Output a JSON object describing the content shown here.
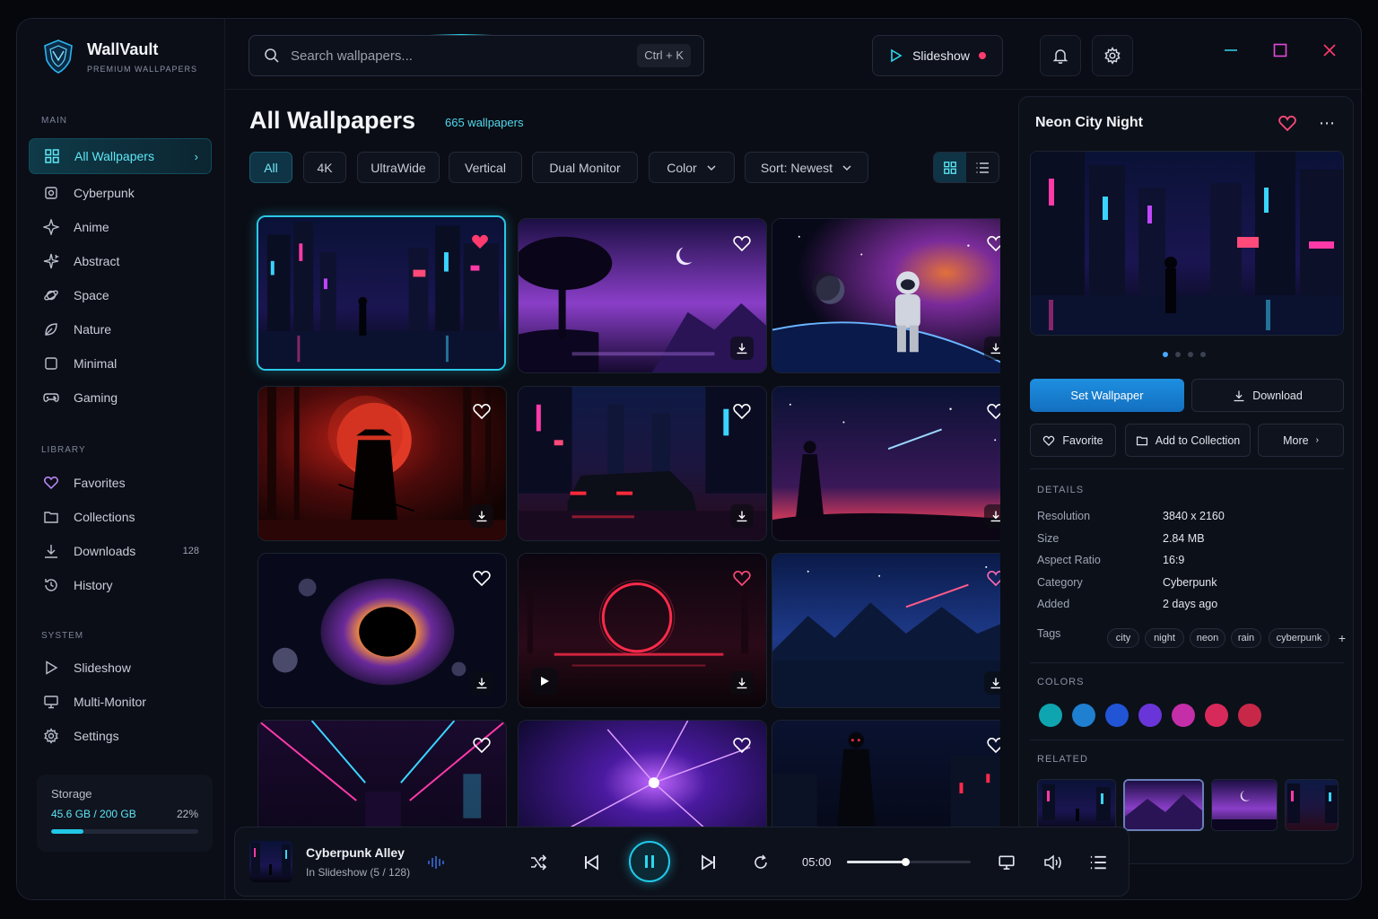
{
  "app": {
    "name": "WallVault",
    "subtitle": "PREMIUM WALLPAPERS"
  },
  "search": {
    "placeholder": "Search wallpapers...",
    "shortcut": "Ctrl + K"
  },
  "topbar": {
    "slideshow_label": "Slideshow"
  },
  "sidebar": {
    "main_label": "MAIN",
    "main_items": [
      {
        "label": "All Wallpapers",
        "icon": "grid-icon"
      },
      {
        "label": "Cyberpunk",
        "icon": "chip-icon"
      },
      {
        "label": "Anime",
        "icon": "sparkle-icon"
      },
      {
        "label": "Abstract",
        "icon": "star-icon"
      },
      {
        "label": "Space",
        "icon": "planet-icon"
      },
      {
        "label": "Nature",
        "icon": "leaf-icon"
      },
      {
        "label": "Minimal",
        "icon": "square-icon"
      },
      {
        "label": "Gaming",
        "icon": "gamepad-icon"
      }
    ],
    "library_label": "LIBRARY",
    "library_items": [
      {
        "label": "Favorites",
        "icon": "heart-icon"
      },
      {
        "label": "Collections",
        "icon": "folder-icon"
      },
      {
        "label": "Downloads",
        "icon": "download-icon",
        "count": "128"
      },
      {
        "label": "History",
        "icon": "history-icon"
      }
    ],
    "system_label": "SYSTEM",
    "system_items": [
      {
        "label": "Slideshow",
        "icon": "play-icon"
      },
      {
        "label": "Multi-Monitor",
        "icon": "monitor-icon"
      },
      {
        "label": "Settings",
        "icon": "gear-icon"
      }
    ],
    "storage": {
      "title": "Storage",
      "used": "45.6 GB / 200 GB",
      "percent_label": "22%",
      "percent": 22
    }
  },
  "main": {
    "title": "All Wallpapers",
    "count": "665 wallpapers",
    "filters": [
      "All",
      "4K",
      "UltraWide",
      "Vertical",
      "Dual Monitor"
    ],
    "color_dropdown": "Color",
    "sort_dropdown": "Sort: Newest"
  },
  "panel": {
    "title": "Neon City Night",
    "set_wallpaper": "Set Wallpaper",
    "download": "Download",
    "favorite": "Favorite",
    "add_to_collection": "Add to Collection",
    "more": "More",
    "details_label": "DETAILS",
    "details": [
      {
        "key": "Resolution",
        "value": "3840 x 2160"
      },
      {
        "key": "Size",
        "value": "2.84 MB"
      },
      {
        "key": "Aspect Ratio",
        "value": "16:9"
      },
      {
        "key": "Category",
        "value": "Cyberpunk"
      },
      {
        "key": "Added",
        "value": "2 days ago"
      }
    ],
    "tags_label": "Tags",
    "tags": [
      "city",
      "night",
      "neon",
      "rain",
      "cyberpunk"
    ],
    "colors_label": "COLORS",
    "colors": [
      "#0fa5b0",
      "#1f7fd0",
      "#2155d6",
      "#6a35d8",
      "#c42ea8",
      "#d82a5a",
      "#c82848"
    ],
    "related_label": "RELATED"
  },
  "player": {
    "title": "Cyberpunk Alley",
    "subtitle": "In Slideshow (5 / 128)",
    "time": "05:00",
    "progress": 0.47
  }
}
